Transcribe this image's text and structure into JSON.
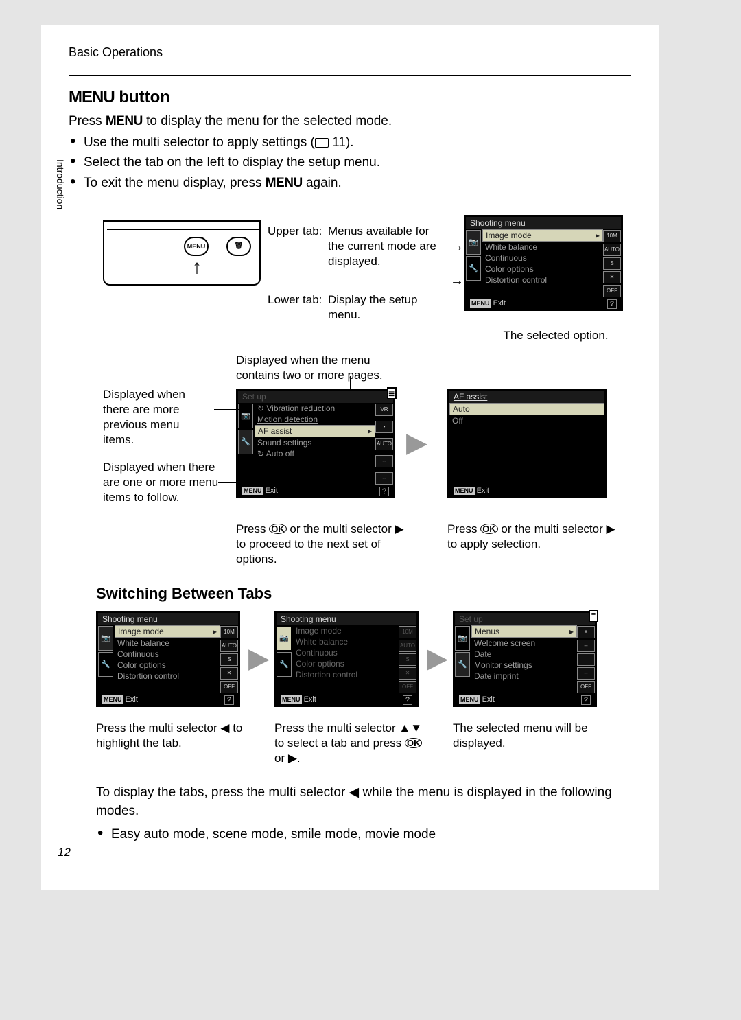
{
  "breadcrumb": "Basic Operations",
  "side_tab": "Introduction",
  "page_number": "12",
  "title_prefix": "MENU",
  "title_suffix": " button",
  "intro_pre": "Press ",
  "intro_menu": "MENU",
  "intro_post": " to display the menu for the selected mode.",
  "bullets": {
    "b1_pre": "Use the multi selector to apply settings (",
    "b1_post": " 11).",
    "b2": "Select the tab on the left to display the setup menu.",
    "b3_pre": "To exit the menu display, press ",
    "b3_menu": "MENU",
    "b3_post": " again."
  },
  "camera_btn1": "MENU",
  "camera_btn2": "🗑",
  "upper_tab_label": "Upper tab:",
  "upper_tab_text": "Menus available for the current mode are displayed.",
  "lower_tab_label": "Lower tab:",
  "lower_tab_text": "Display the setup menu.",
  "selected_option_label": "The selected option.",
  "two_pages_label": "Displayed when the menu contains two or more pages.",
  "prev_items_label": "Displayed when there are more previous menu items.",
  "more_items_label": "Displayed when there are one or more menu items to follow.",
  "press_ok_next": "Press k or the multi selector ▶ to proceed to the next set of options.",
  "press_ok_apply": "Press k or the multi selector ▶ to apply selection.",
  "h2": "Switching Between Tabs",
  "switch_cap1": "Press the multi selector ◀ to highlight the tab.",
  "switch_cap2": "Press the multi selector ▲▼ to select a tab and press k or ▶.",
  "switch_cap3": "The selected menu will be displayed.",
  "tabs_note": "To display the tabs, press the multi selector ◀ while the menu is displayed in the following modes.",
  "tabs_bullet": "Easy auto mode, scene mode, smile mode, movie mode",
  "lcd1": {
    "title": "Shooting menu",
    "items": [
      "Image mode",
      "White balance",
      "Continuous",
      "Color options",
      "Distortion control"
    ],
    "vals": [
      "10M",
      "AUTO",
      "S",
      "✕",
      "OFF"
    ],
    "exit": "Exit"
  },
  "lcd_setup": {
    "title": "Set up",
    "items": [
      "Vibration reduction",
      "Motion detection",
      "AF assist",
      "Sound settings",
      "Auto off"
    ],
    "vals": [
      "VR",
      "•",
      "AUTO",
      "--",
      "--"
    ],
    "exit": "Exit"
  },
  "lcd_af": {
    "title": "AF assist",
    "items": [
      "Auto",
      "Off"
    ],
    "exit": "Exit"
  },
  "lcd_setup2": {
    "title": "Set up",
    "items": [
      "Menus",
      "Welcome screen",
      "Date",
      "Monitor settings",
      "Date imprint"
    ],
    "vals": [
      "≡",
      "--",
      "",
      "--",
      "OFF"
    ],
    "exit": "Exit"
  }
}
